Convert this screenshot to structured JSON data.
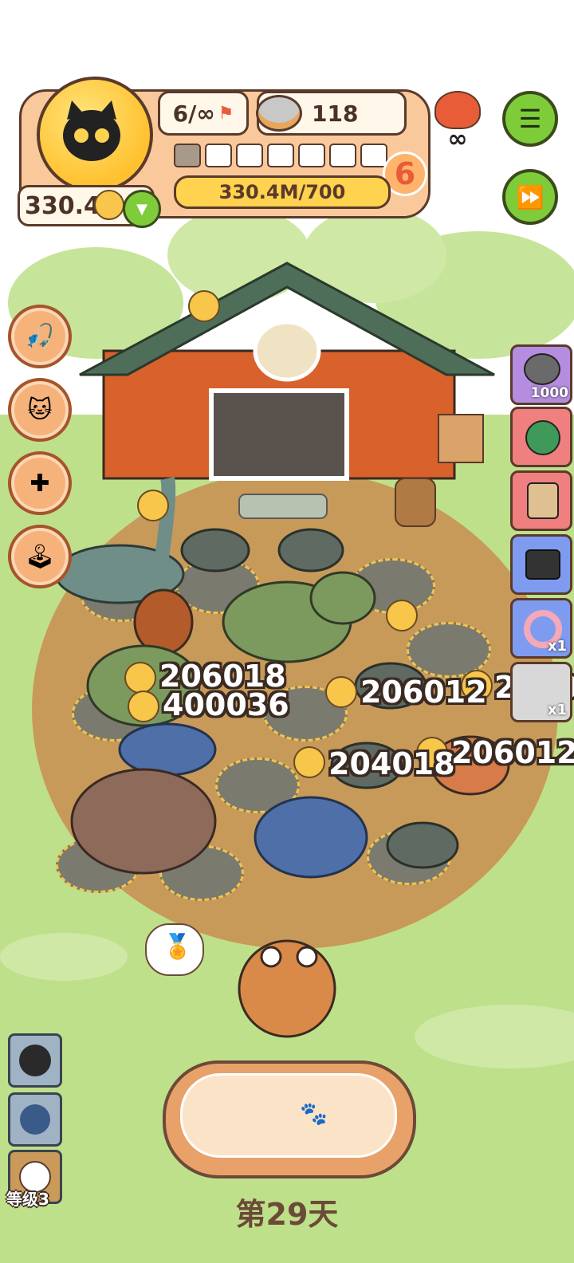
{
  "hud": {
    "battle_count": "6/∞",
    "coins": "118",
    "currency": "330.4M",
    "level_segments_total": 7,
    "level_segments_filled": 1,
    "level": "6",
    "xp_text": "330.4M/700",
    "infinity": "∞"
  },
  "right_column": {
    "card1_count": "1000",
    "card5_count": "x1",
    "card6_count": "x1"
  },
  "damage_numbers": [
    "206018",
    "400036",
    "206012",
    "2040",
    "204018",
    "206012"
  ],
  "bottom_left": {
    "level_label": "等级3"
  },
  "day_label": "第29天",
  "colors": {
    "grass": "#bfe08a",
    "barn": "#d9612b",
    "dirt": "#c79a5a",
    "hud_orange": "#f9c99b",
    "green_button": "#7fcc3a"
  }
}
